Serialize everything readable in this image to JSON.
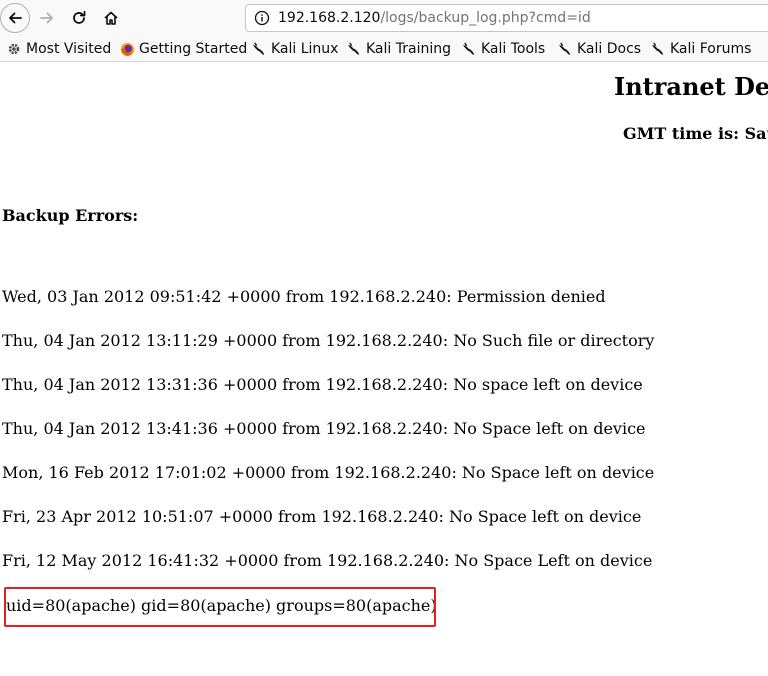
{
  "browser": {
    "url": {
      "host": "192.168.2.120",
      "path": "/logs/backup_log.php?cmd=id"
    },
    "bookmarks": [
      {
        "label": "Most Visited",
        "icon": "gear-icon"
      },
      {
        "label": "Getting Started",
        "icon": "firefox-icon"
      },
      {
        "label": "Kali Linux",
        "icon": "kali-dragon-icon"
      },
      {
        "label": "Kali Training",
        "icon": "kali-dragon-icon"
      },
      {
        "label": "Kali Tools",
        "icon": "kali-dragon-icon"
      },
      {
        "label": "Kali Docs",
        "icon": "kali-dragon-icon"
      },
      {
        "label": "Kali Forums",
        "icon": "kali-dragon-icon"
      }
    ]
  },
  "page": {
    "title": "Intranet De",
    "gmt_time": "GMT time is: Sat",
    "backup_heading": "Backup Errors:",
    "log_entries": [
      "Wed, 03 Jan 2012 09:51:42 +0000 from 192.168.2.240: Permission denied",
      "Thu, 04 Jan 2012 13:11:29 +0000 from 192.168.2.240: No Such file or directory",
      "Thu, 04 Jan 2012 13:31:36 +0000 from 192.168.2.240: No space left on device",
      "Thu, 04 Jan 2012 13:41:36 +0000 from 192.168.2.240: No Space left on device",
      "Mon, 16 Feb 2012 17:01:02 +0000 from 192.168.2.240: No Space left on device",
      "Fri, 23 Apr 2012 10:51:07 +0000 from 192.168.2.240: No Space left on device",
      "Fri, 12 May 2012 16:41:32 +0000 from 192.168.2.240: No Space Left on device"
    ],
    "command_output": "uid=80(apache) gid=80(apache) groups=80(apache)"
  },
  "colors": {
    "highlight_border": "#e02020",
    "chrome_bg": "#f9f9fa"
  }
}
